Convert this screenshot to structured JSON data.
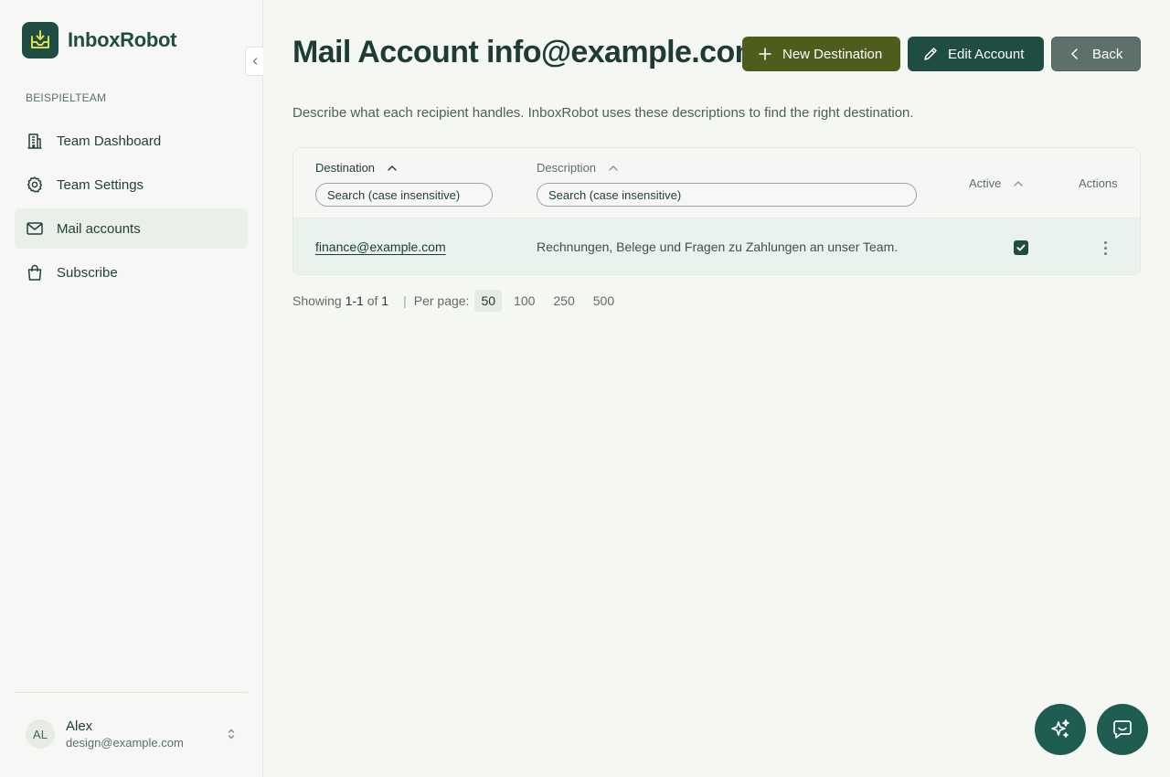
{
  "brand": {
    "name": "InboxRobot"
  },
  "sidebar": {
    "team_label": "BEISPIELTEAM",
    "items": [
      {
        "label": "Team Dashboard",
        "icon": "building-icon"
      },
      {
        "label": "Team Settings",
        "icon": "gear-icon"
      },
      {
        "label": "Mail accounts",
        "icon": "mail-icon",
        "active": true
      },
      {
        "label": "Subscribe",
        "icon": "shopping-bag-icon"
      }
    ],
    "user": {
      "initials": "AL",
      "name": "Alex",
      "email": "design@example.com"
    }
  },
  "header": {
    "title": "Mail Account info@example.com",
    "new_label": "New Destination",
    "edit_label": "Edit Account",
    "back_label": "Back",
    "subtitle": "Describe what each recipient handles. InboxRobot uses these descriptions to find the right destination."
  },
  "table": {
    "columns": {
      "destination": "Destination",
      "description": "Description",
      "active": "Active",
      "actions": "Actions"
    },
    "search_placeholder": "Search (case insensitive)",
    "rows": [
      {
        "destination": "finance@example.com",
        "description": "Rechnungen, Belege und Fragen zu Zahlungen an unser Team.",
        "active": true
      }
    ]
  },
  "pagination": {
    "showing": "Showing",
    "range": "1-1",
    "of": "of",
    "total": "1",
    "per_page_label": "Per page:",
    "options": [
      "50",
      "100",
      "250",
      "500"
    ],
    "selected": "50"
  },
  "colors": {
    "primary": "#1f4d44",
    "olive": "#4e5d1c",
    "back_button": "#5d706b",
    "row_highlight": "#e9f2ec"
  }
}
